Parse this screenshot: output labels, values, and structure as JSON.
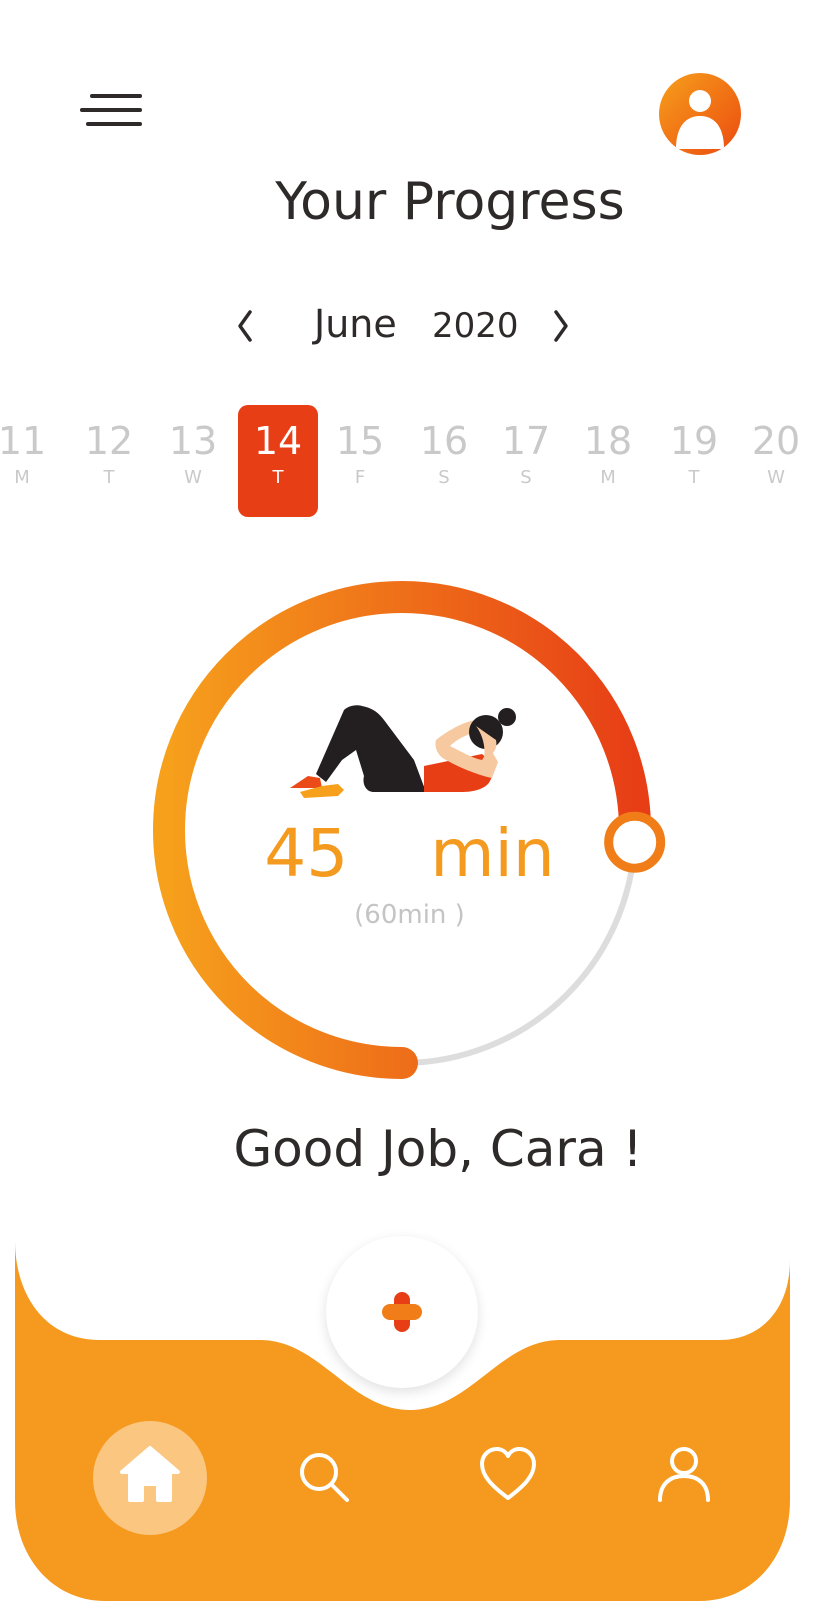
{
  "header": {
    "title": "Your Progress",
    "menu_icon": "hamburger-menu-icon",
    "avatar_icon": "user-avatar-icon"
  },
  "month_selector": {
    "month": "June",
    "year": "2020",
    "prev_icon": "chevron-left-icon",
    "next_icon": "chevron-right-icon"
  },
  "dates": [
    {
      "day": "11",
      "weekday": "M",
      "active": false
    },
    {
      "day": "12",
      "weekday": "T",
      "active": false
    },
    {
      "day": "13",
      "weekday": "W",
      "active": false
    },
    {
      "day": "14",
      "weekday": "T",
      "active": true
    },
    {
      "day": "15",
      "weekday": "F",
      "active": false
    },
    {
      "day": "16",
      "weekday": "S",
      "active": false
    },
    {
      "day": "17",
      "weekday": "S",
      "active": false
    },
    {
      "day": "18",
      "weekday": "M",
      "active": false
    },
    {
      "day": "19",
      "weekday": "T",
      "active": false
    },
    {
      "day": "20",
      "weekday": "W",
      "active": false
    }
  ],
  "progress": {
    "value": "45",
    "unit": "min",
    "goal_label": "(60min )",
    "fraction": 0.75,
    "illustration": "woman-doing-crunches-illustration"
  },
  "greeting": "Good Job, Cara !",
  "bottom_nav": {
    "add_icon": "plus-icon",
    "items": [
      {
        "icon": "home-icon",
        "active": true
      },
      {
        "icon": "search-icon",
        "active": false
      },
      {
        "icon": "heart-icon",
        "active": false
      },
      {
        "icon": "user-icon",
        "active": false
      }
    ]
  },
  "colors": {
    "accent_orange": "#f39a1f",
    "accent_red": "#e73e16",
    "track_gray": "#dddddd",
    "nav_bg": "#f59a1f",
    "home_highlight": "#fac680"
  }
}
